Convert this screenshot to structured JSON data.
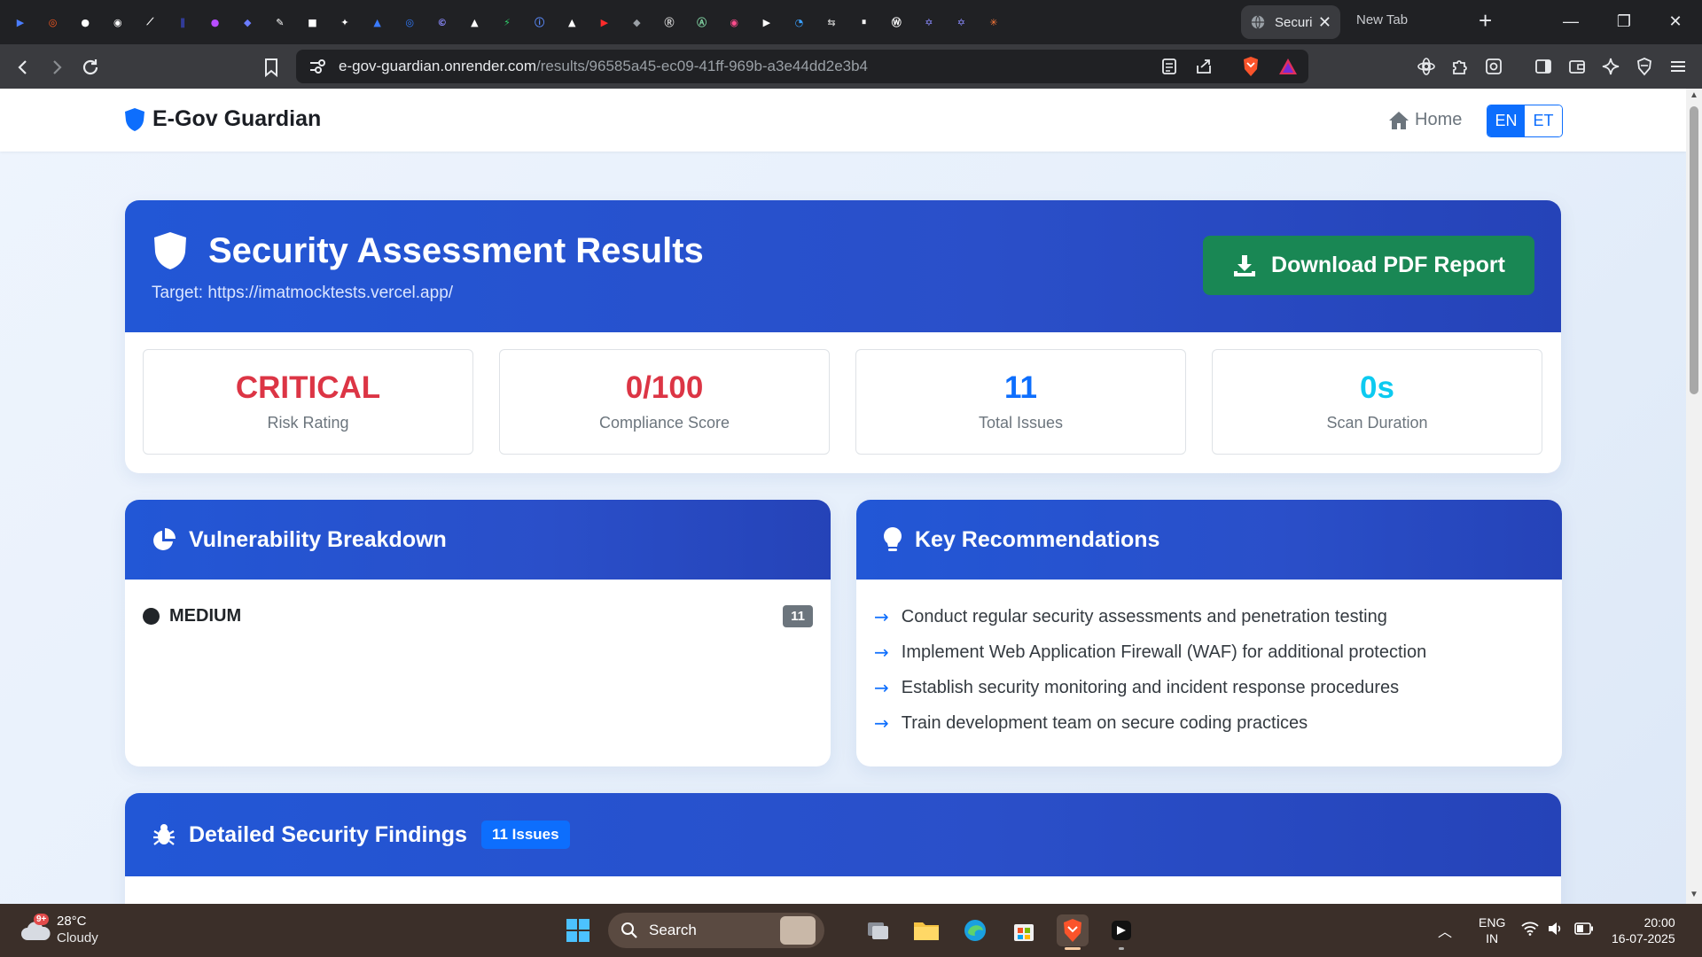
{
  "browser": {
    "pinned_tabs": [
      {
        "icon": "play-arrow-icon",
        "color": "#4a7dff"
      },
      {
        "icon": "ring-icon",
        "color": "#ff5a1f"
      },
      {
        "icon": "github-icon",
        "color": "#ffffff"
      },
      {
        "icon": "spiral-icon",
        "color": "#ffffff"
      },
      {
        "icon": "link-icon",
        "color": "#ffffff"
      },
      {
        "icon": "bars-icon",
        "color": "#3b4bd8"
      },
      {
        "icon": "gradient-circle-icon",
        "color": "#b84dff"
      },
      {
        "icon": "bird-icon",
        "color": "#6b7cff"
      },
      {
        "icon": "pen-icon",
        "color": "#ffffff"
      },
      {
        "icon": "box-icon",
        "color": "#ffffff"
      },
      {
        "icon": "sparkle-icon",
        "color": "#ffffff"
      },
      {
        "icon": "mountain-icon",
        "color": "#3a7bff"
      },
      {
        "icon": "target-icon",
        "color": "#2f7bff"
      },
      {
        "icon": "c-circle-icon",
        "color": "#8b8bff"
      },
      {
        "icon": "triangle-icon",
        "color": "#ffffff"
      },
      {
        "icon": "bolt-icon",
        "color": "#2fcf6a"
      },
      {
        "icon": "info-circle-icon",
        "color": "#5b8cff"
      },
      {
        "icon": "triangle-dark-icon",
        "color": "#ffffff"
      },
      {
        "icon": "youtube-icon",
        "color": "#ff2b2b"
      },
      {
        "icon": "diamond-icon",
        "color": "#9aa0a6"
      },
      {
        "icon": "r-circle-icon",
        "color": "#c8c8c8"
      },
      {
        "icon": "ai-circle-icon",
        "color": "#7fd0a0"
      },
      {
        "icon": "record-icon",
        "color": "#ff4d8d"
      },
      {
        "icon": "play-circle-icon",
        "color": "#ffffff"
      },
      {
        "icon": "swirl-icon",
        "color": "#3aa0ff"
      },
      {
        "icon": "arrows-circle-icon",
        "color": "#c8c8c8"
      },
      {
        "icon": "pause-circle-icon",
        "color": "#ffffff"
      },
      {
        "icon": "w-circle-icon",
        "color": "#ffffff"
      },
      {
        "icon": "star-of-david-icon",
        "color": "#8a8aff"
      },
      {
        "icon": "star-of-david-alt-icon",
        "color": "#8a8aff"
      },
      {
        "icon": "asterisk-icon",
        "color": "#ff7a3a"
      }
    ],
    "active_tab": "Securi",
    "other_tab": "New Tab",
    "new_tab_symbol": "+",
    "url_host": "e-gov-guardian.onrender.com",
    "url_path": "/results/96585a45-ec09-41ff-969b-a3e44dd2e3b4",
    "window_controls": {
      "minimize": "—",
      "restore": "❐",
      "close": "✕"
    }
  },
  "site": {
    "brand": "E-Gov Guardian",
    "home_label": "Home",
    "lang_en": "EN",
    "lang_et": "ET"
  },
  "results": {
    "title": "Security Assessment Results",
    "target_label": "Target:",
    "target_url": "https://imatmocktests.vercel.app/",
    "download_label": "Download PDF Report",
    "stats": [
      {
        "value": "CRITICAL",
        "label": "Risk Rating",
        "color": "#dc3545"
      },
      {
        "value": "0/100",
        "label": "Compliance Score",
        "color": "#dc3545"
      },
      {
        "value": "11",
        "label": "Total Issues",
        "color": "#0d6efd"
      },
      {
        "value": "0s",
        "label": "Scan Duration",
        "color": "#0dcaf0"
      }
    ]
  },
  "vulnerability": {
    "title": "Vulnerability Breakdown",
    "rows": [
      {
        "severity": "MEDIUM",
        "count": "11"
      }
    ]
  },
  "recommendations": {
    "title": "Key Recommendations",
    "items": [
      "Conduct regular security assessments and penetration testing",
      "Implement Web Application Firewall (WAF) for additional protection",
      "Establish security monitoring and incident response procedures",
      "Train development team on secure coding practices"
    ]
  },
  "findings": {
    "title": "Detailed Security Findings",
    "badge": "11 Issues"
  },
  "taskbar": {
    "weather_badge": "9+",
    "temperature": "28°C",
    "condition": "Cloudy",
    "search_label": "Search",
    "language": "ENG",
    "region": "IN",
    "time": "20:00",
    "date": "16-07-2025"
  }
}
